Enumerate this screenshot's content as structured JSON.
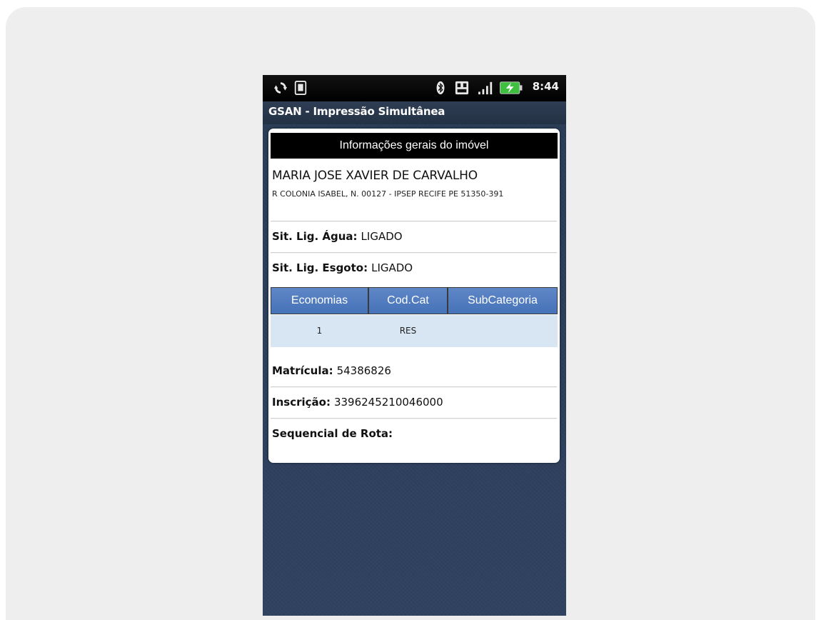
{
  "status_bar": {
    "time": "8:44",
    "icons": [
      "sync-icon",
      "sim-card-icon",
      "bluetooth-icon",
      "notification-icon",
      "signal-icon",
      "battery-charging-icon"
    ]
  },
  "app": {
    "title": "GSAN - Impressão Simultânea"
  },
  "card": {
    "header": "Informações gerais do imóvel",
    "owner_name": "MARIA JOSE XAVIER DE CARVALHO",
    "address": "R COLONIA ISABEL, N. 00127 - IPSEP RECIFE PE 51350-391",
    "sit_agua": {
      "label": "Sit. Lig. Água:",
      "value": "LIGADO"
    },
    "sit_esgoto": {
      "label": "Sit. Lig. Esgoto:",
      "value": "LIGADO"
    },
    "table": {
      "headers": [
        "Economias",
        "Cod.Cat",
        "SubCategoria"
      ],
      "rows": [
        [
          "1",
          "RES",
          ""
        ]
      ]
    },
    "matricula": {
      "label": "Matrícula:",
      "value": "54386826"
    },
    "inscricao": {
      "label": "Inscrição:",
      "value": "3396245210046000"
    },
    "sequencial": {
      "label": "Sequencial de Rota:",
      "value": ""
    }
  },
  "colors": {
    "table_header": "#4f7bbf",
    "table_row": "#d8e6f3",
    "card_header": "#000000",
    "background": "#2c3e58"
  }
}
